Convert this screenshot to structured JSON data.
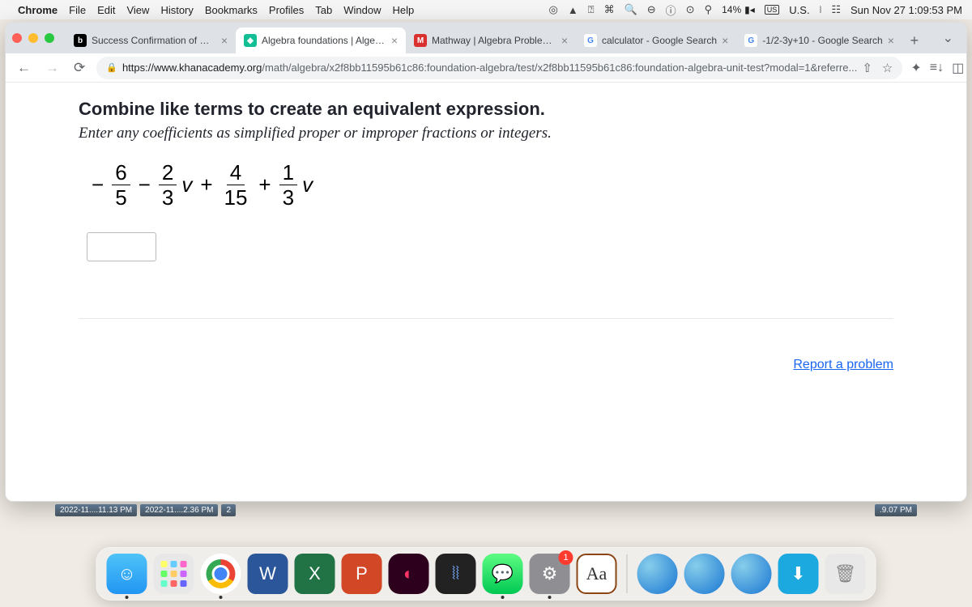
{
  "menubar": {
    "app": "Chrome",
    "items": [
      "File",
      "Edit",
      "View",
      "History",
      "Bookmarks",
      "Profiles",
      "Tab",
      "Window",
      "Help"
    ],
    "battery": "14%",
    "input": "U.S.",
    "clock": "Sun Nov 27  1:09:53 PM"
  },
  "tabs": [
    {
      "title": "Success Confirmation of Ques",
      "fav": "b",
      "favbg": "#000",
      "favcolor": "#fff"
    },
    {
      "title": "Algebra foundations | Algebra",
      "fav": "◆",
      "favbg": "#14bf96",
      "favcolor": "#fff",
      "active": true
    },
    {
      "title": "Mathway | Algebra Problem So",
      "fav": "M",
      "favbg": "#d93030",
      "favcolor": "#fff"
    },
    {
      "title": "calculator - Google Search",
      "fav": "G",
      "favbg": "#fff",
      "favcolor": "#4285f4"
    },
    {
      "title": "-1/2-3y+10 - Google Search",
      "fav": "G",
      "favbg": "#fff",
      "favcolor": "#4285f4"
    }
  ],
  "url": {
    "domain": "https://www.khanacademy.org",
    "path": "/math/algebra/x2f8bb11595b61c86:foundation-algebra/test/x2f8bb11595b61c86:foundation-algebra-unit-test?modal=1&referre..."
  },
  "problem": {
    "line1": "Combine like terms to create an equivalent expression.",
    "line2": "Enter any coefficients as simplified proper or improper fractions or integers.",
    "expr": {
      "t1": {
        "num": "6",
        "den": "5"
      },
      "t2": {
        "num": "2",
        "den": "3"
      },
      "t3": {
        "num": "4",
        "den": "15"
      },
      "t4": {
        "num": "1",
        "den": "3"
      },
      "var": "v"
    },
    "answer": "",
    "report": "Report a problem"
  },
  "thumbs": {
    "a": "2022-11....11.13 PM",
    "b": "2022-11....2.36 PM",
    "c": "2",
    "r": ".9.07 PM"
  },
  "dock": {
    "word": "W",
    "excel": "X",
    "ppt": "P",
    "dict": "Aa",
    "pref_badge": "1"
  }
}
